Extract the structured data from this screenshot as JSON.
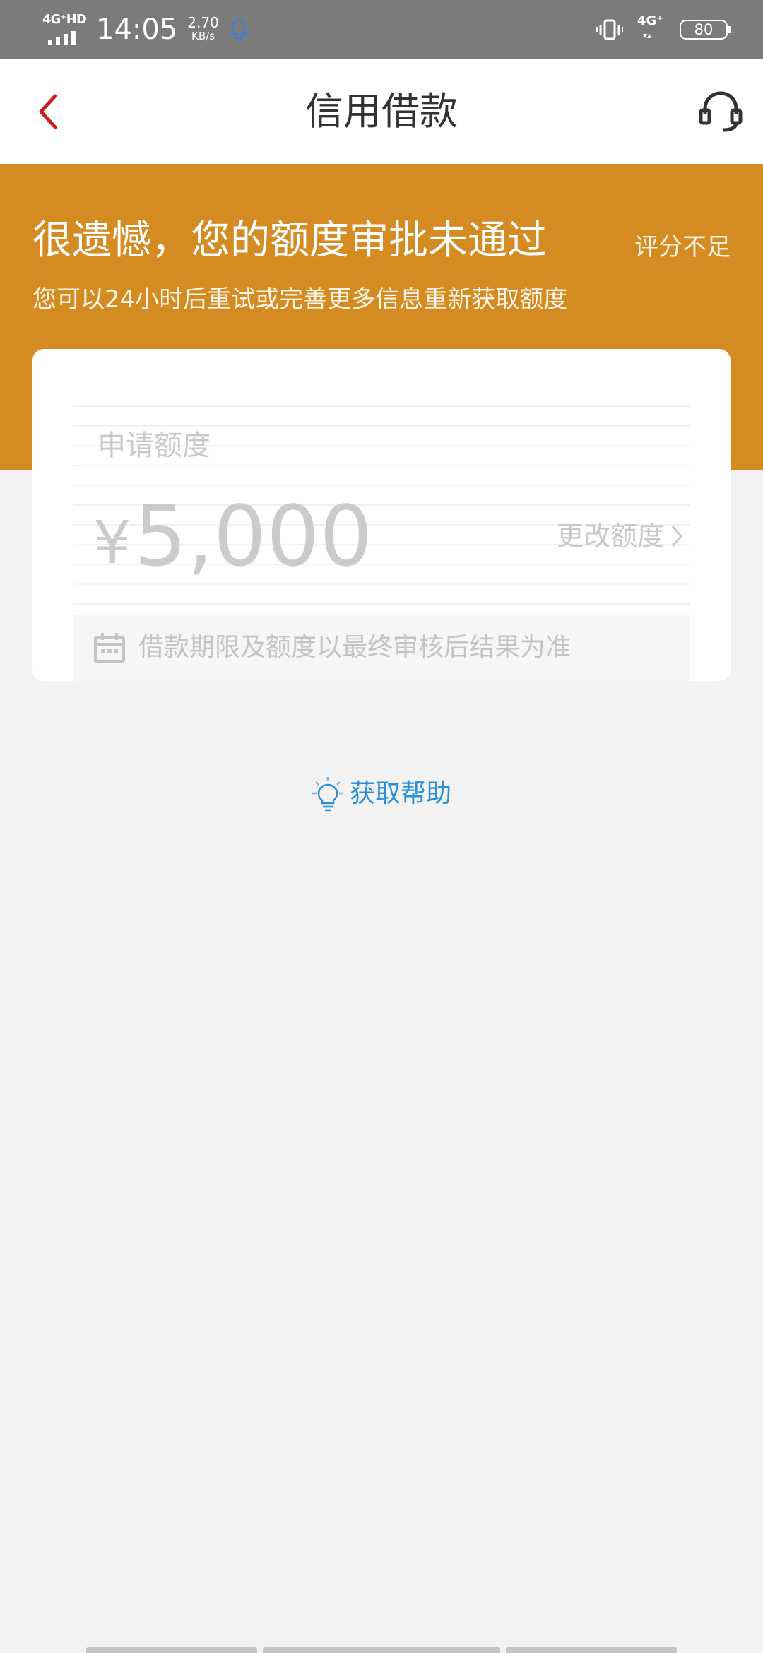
{
  "status_bar": {
    "network_left": "4G⁺HD",
    "time": "14:05",
    "speed_value": "2.70",
    "speed_unit": "KB/s",
    "network_right": "4G⁺",
    "battery": "80"
  },
  "nav": {
    "title": "信用借款",
    "back_icon": "chevron-left-icon",
    "service_icon": "headset-icon",
    "accent_color": "#c81e1e"
  },
  "banner": {
    "title": "很遗憾，您的额度审批未通过",
    "reason": "评分不足",
    "hint": "您可以24小时后重试或完善更多信息重新获取额度",
    "background_color": "#d38b22"
  },
  "credit_card": {
    "amount_label": "申请额度",
    "currency_symbol": "¥",
    "amount": "5,000",
    "change_label": "更改额度",
    "notice": "借款期限及额度以最终审核后结果为准",
    "notice_icon": "calendar-icon"
  },
  "help": {
    "label": "获取帮助",
    "icon": "lightbulb-icon",
    "color": "#2a8fd6"
  }
}
